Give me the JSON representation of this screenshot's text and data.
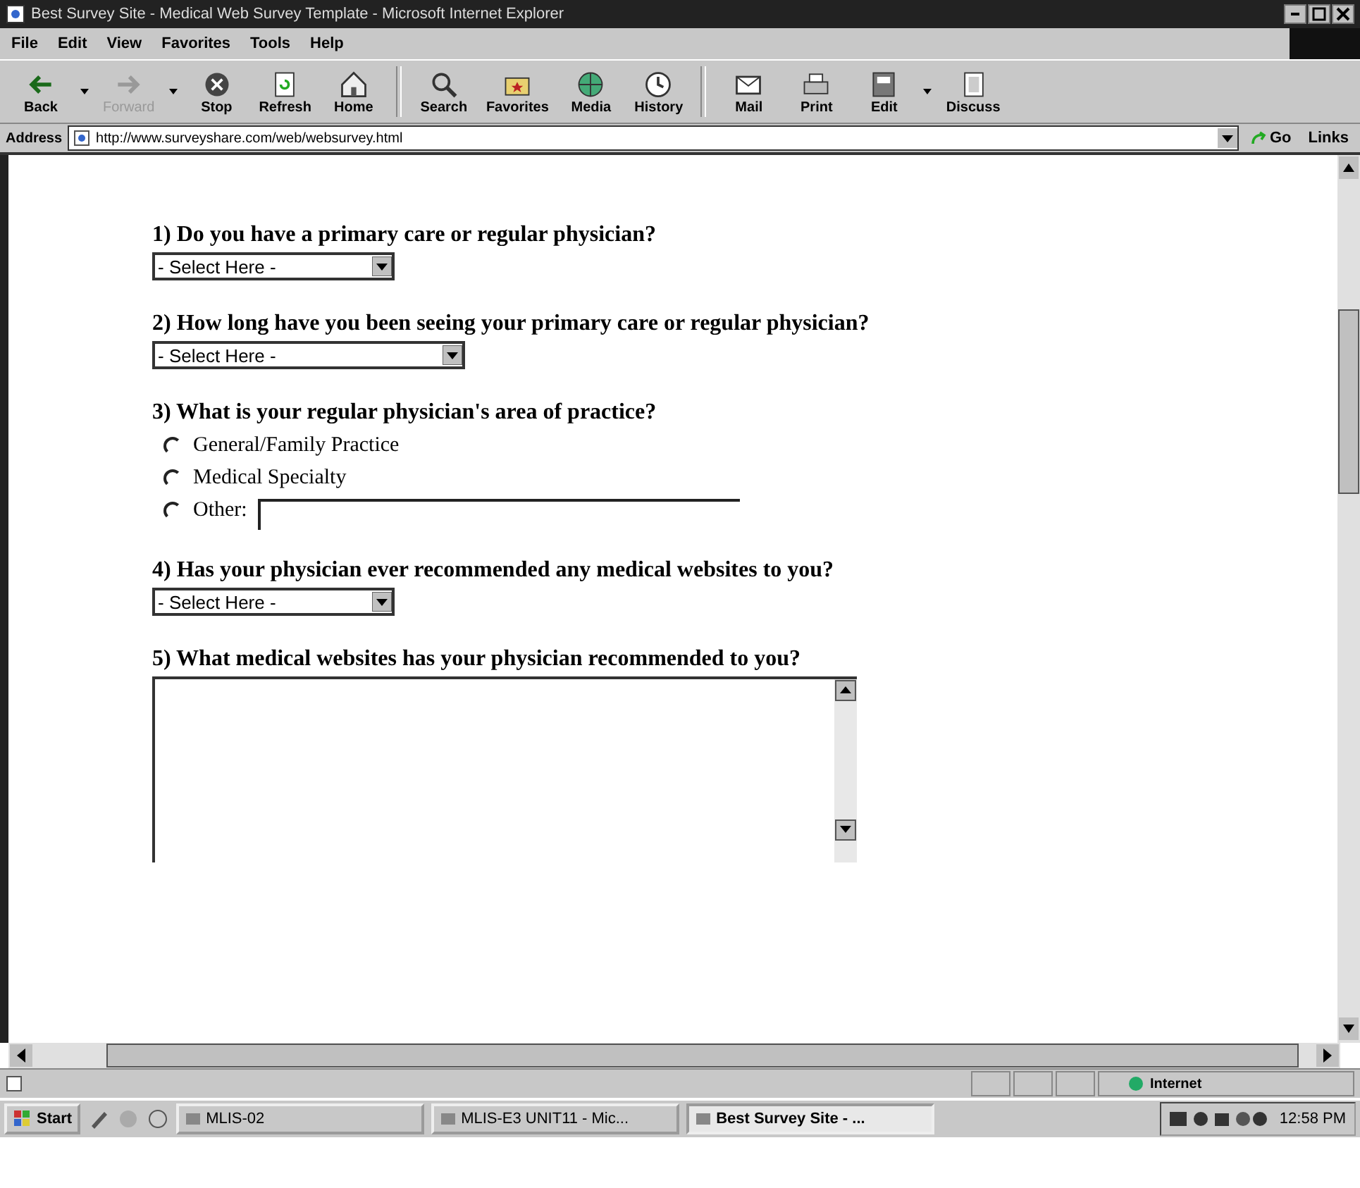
{
  "window": {
    "title": "Best Survey Site - Medical Web Survey Template - Microsoft Internet Explorer"
  },
  "menu": [
    "File",
    "Edit",
    "View",
    "Favorites",
    "Tools",
    "Help"
  ],
  "toolbar": [
    {
      "label": "Back",
      "disabled": false,
      "dropdown": true
    },
    {
      "label": "Forward",
      "disabled": true,
      "dropdown": true
    },
    {
      "label": "Stop",
      "disabled": false,
      "dropdown": false
    },
    {
      "label": "Refresh",
      "disabled": false,
      "dropdown": false
    },
    {
      "label": "Home",
      "disabled": false,
      "dropdown": false
    },
    {
      "label": "Search",
      "disabled": false,
      "dropdown": false
    },
    {
      "label": "Favorites",
      "disabled": false,
      "dropdown": false
    },
    {
      "label": "Media",
      "disabled": false,
      "dropdown": false
    },
    {
      "label": "History",
      "disabled": false,
      "dropdown": false
    },
    {
      "label": "Mail",
      "disabled": false,
      "dropdown": false
    },
    {
      "label": "Print",
      "disabled": false,
      "dropdown": false
    },
    {
      "label": "Edit",
      "disabled": false,
      "dropdown": true
    },
    {
      "label": "Discuss",
      "disabled": false,
      "dropdown": false
    }
  ],
  "address": {
    "label": "Address",
    "value": "http://www.surveyshare.com/web/websurvey.html",
    "go": "Go",
    "links": "Links"
  },
  "questions": [
    {
      "kind": "select",
      "text": "1) Do you have a primary care or regular physician?",
      "value": "- Select Here -",
      "wide": false
    },
    {
      "kind": "select",
      "text": "2) How long have you been seeing your primary care or regular physician?",
      "value": "- Select Here -",
      "wide": true
    },
    {
      "kind": "radio",
      "text": "3) What is your regular physician's area of practice?",
      "options": [
        {
          "kind": "choice",
          "label": "General/Family Practice",
          "selected": false
        },
        {
          "kind": "choice",
          "label": "Medical Specialty",
          "selected": false
        },
        {
          "kind": "choice_with_field",
          "label": "Other:",
          "selected": false
        }
      ]
    },
    {
      "kind": "select",
      "text": "4) Has your physician ever recommended any medical websites to you?",
      "value": "- Select Here -",
      "wide": false
    },
    {
      "kind": "textarea",
      "text": "5) What medical websites has your physician recommended to you?"
    }
  ],
  "status_bar": {
    "zone": "Internet"
  },
  "taskbar": {
    "start": "Start",
    "tasks": [
      {
        "label": "MLIS-02",
        "selected": false
      },
      {
        "label": "MLIS-E3 UNIT11 - Mic...",
        "selected": false
      },
      {
        "label": "Best Survey Site - ...",
        "selected": true
      }
    ],
    "clock": "12:58 PM"
  }
}
